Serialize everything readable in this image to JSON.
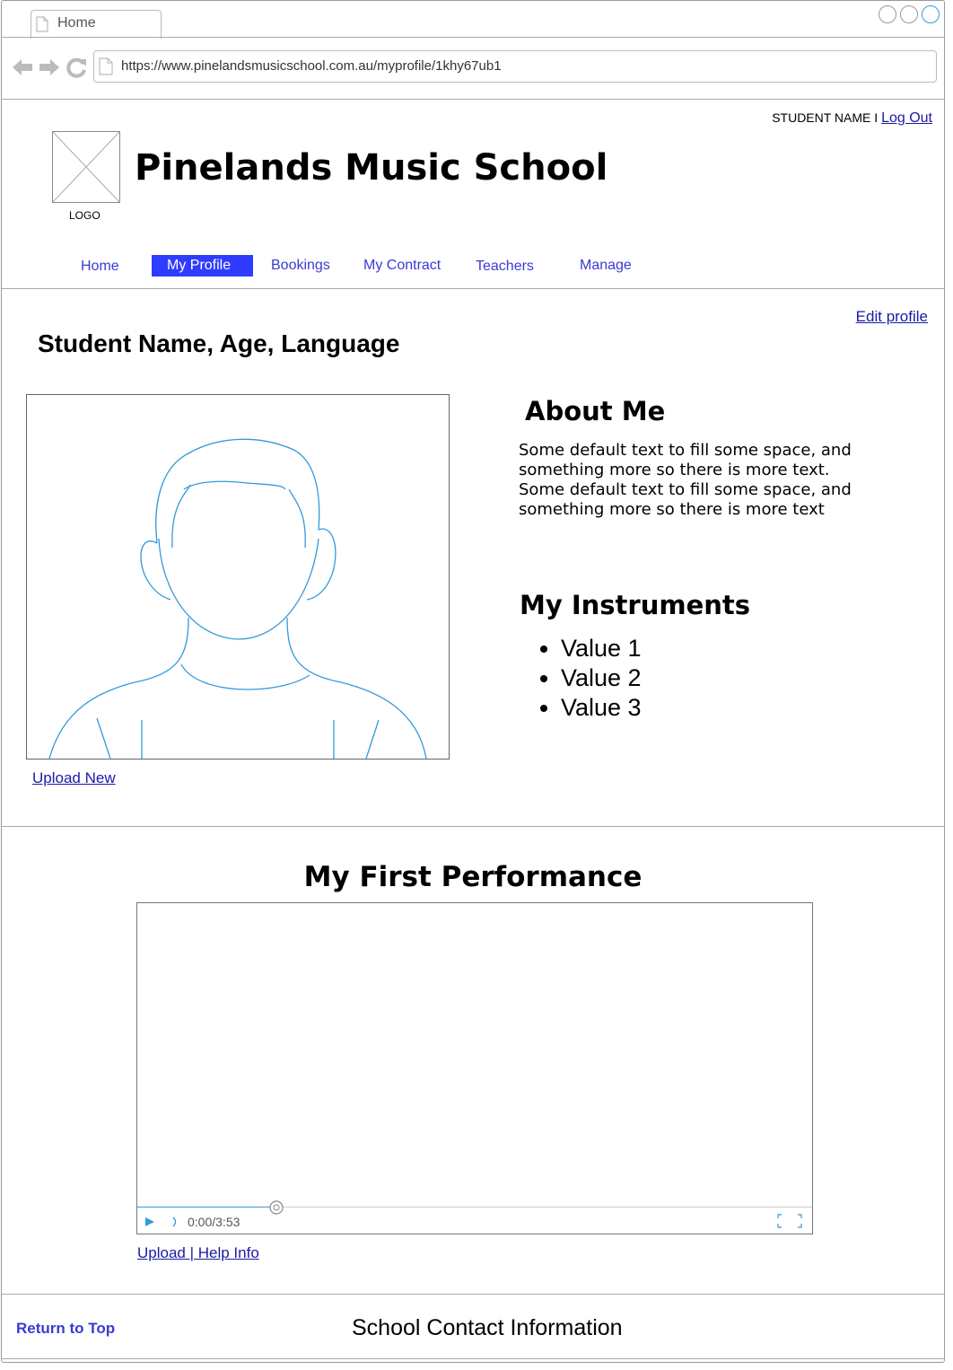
{
  "browser": {
    "tab_title": "Home",
    "url": "https://www.pinelandsmusicschool.com.au/myprofile/1khy67ub1"
  },
  "header": {
    "user_name": "STUDENT NAME",
    "separator": " I ",
    "logout_label": "Log Out",
    "logo_caption": "LOGO",
    "site_title": "Pinelands Music School"
  },
  "nav": {
    "items": [
      {
        "label": "Home"
      },
      {
        "label": "My Profile"
      },
      {
        "label": "Bookings"
      },
      {
        "label": "My Contract"
      },
      {
        "label": "Teachers"
      },
      {
        "label": "Manage"
      }
    ],
    "active": "My Profile"
  },
  "profile": {
    "edit_label": "Edit profile",
    "name_heading": "Student Name, Age, Language",
    "upload_label": "Upload New",
    "about_heading": "About Me",
    "about_text": "Some default text to fill some space, and something more so there is more text. Some default text to fill some space, and something more so there is more text",
    "instruments_heading": "My Instruments",
    "instruments": [
      "Value 1",
      "Value 2",
      "Value 3"
    ]
  },
  "performance": {
    "heading": "My First Performance",
    "time": "0:00/3:53",
    "links_label": "Upload | Help Info"
  },
  "footer": {
    "return_label": "Return to Top",
    "contact_label": "School Contact Information"
  },
  "colors": {
    "nav_active_bg": "#2f3cff",
    "link": "#1a1aa6",
    "avatar_stroke": "#3399dd"
  }
}
